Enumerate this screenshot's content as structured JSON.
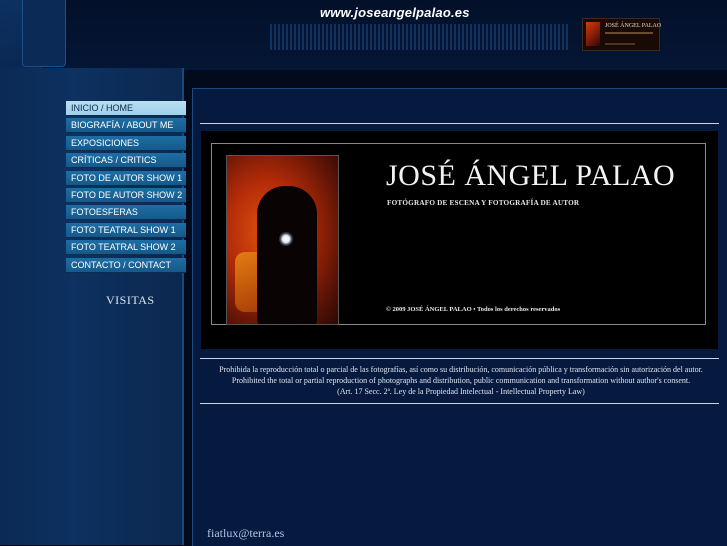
{
  "header": {
    "site_url": "www.joseangelpalao.es"
  },
  "nav": {
    "items": [
      {
        "label": "INICIO / HOME",
        "active": true
      },
      {
        "label": "BIOGRAFÍA / ABOUT ME",
        "active": false
      },
      {
        "label": "EXPOSICIONES",
        "active": false
      },
      {
        "label": "CRÍTICAS / CRITICS",
        "active": false
      },
      {
        "label": "FOTO DE AUTOR SHOW 1",
        "active": false
      },
      {
        "label": "FOTO DE AUTOR SHOW 2",
        "active": false
      },
      {
        "label": "FOTOESFERAS",
        "active": false
      },
      {
        "label": "FOTO TEATRAL SHOW 1",
        "active": false
      },
      {
        "label": "FOTO TEATRAL SHOW 2",
        "active": false
      },
      {
        "label": "CONTACTO / CONTACT",
        "active": false
      }
    ]
  },
  "sidebar": {
    "visitas_label": "VISITAS"
  },
  "banner": {
    "name": "JOSÉ ÁNGEL PALAO",
    "subtitle": "FOTÓGRAFO DE ESCENA Y FOTOGRAFÍA DE AUTOR",
    "copyright": "© 2009 JOSÉ ÁNGEL PALAO • Todos los derechos reservados"
  },
  "legal": {
    "line1": "Prohibida la reproducción total o parcial de las fotografías, así como su distribución, comunicación pública y transformación sin autorización del autor.",
    "line2": "Prohibited the total or partial reproduction of photographs and distribution, public communication and transformation without author's consent.",
    "line3": "(Art. 17 Secc. 2ª. Ley de la Propiedad Intelectual - Intellectual Property Law)"
  },
  "footer": {
    "email": "fiatlux@terra.es"
  },
  "colors": {
    "background": "#020a1c",
    "nav_item": "#1d6ea4",
    "nav_active": "#b9dff2",
    "main_panel": "#051a3e"
  }
}
